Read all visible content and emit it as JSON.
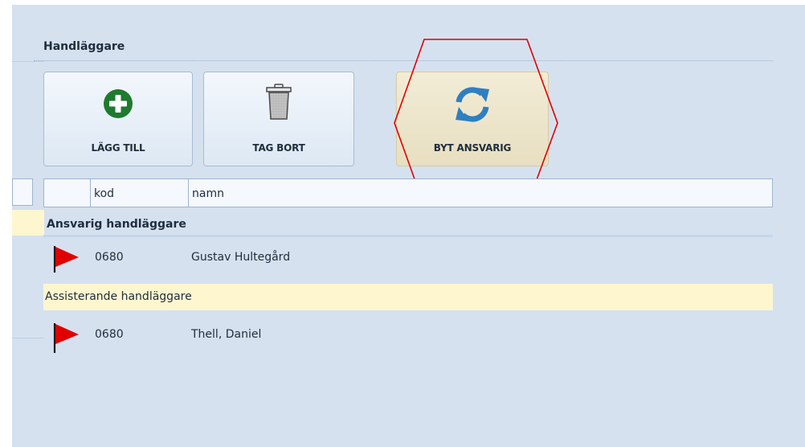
{
  "section": {
    "title": "Handläggare"
  },
  "toolbar": {
    "add_label": "LÄGG TILL",
    "delete_label": "TAG BORT",
    "swap_label": "BYT ANSVARIG"
  },
  "grid": {
    "columns": [
      "",
      "kod",
      "namn"
    ]
  },
  "groups": [
    {
      "label": "Ansvarig handläggare",
      "rows": [
        {
          "icon": "red-flag-icon",
          "code": "0680",
          "name": "Gustav Hultegård"
        }
      ]
    },
    {
      "label": "Assisterande handläggare",
      "rows": [
        {
          "icon": "red-flag-icon",
          "code": "0680",
          "name": "Thell, Daniel"
        }
      ]
    }
  ],
  "colors": {
    "panel_bg": "#d5e1ef",
    "add_icon": "#1e7a2e",
    "swap_icon": "#2f7fc1",
    "flag": "#e00000",
    "highlight_hexagon": "#e00000",
    "assist_group_bg": "#fdf6cf"
  }
}
